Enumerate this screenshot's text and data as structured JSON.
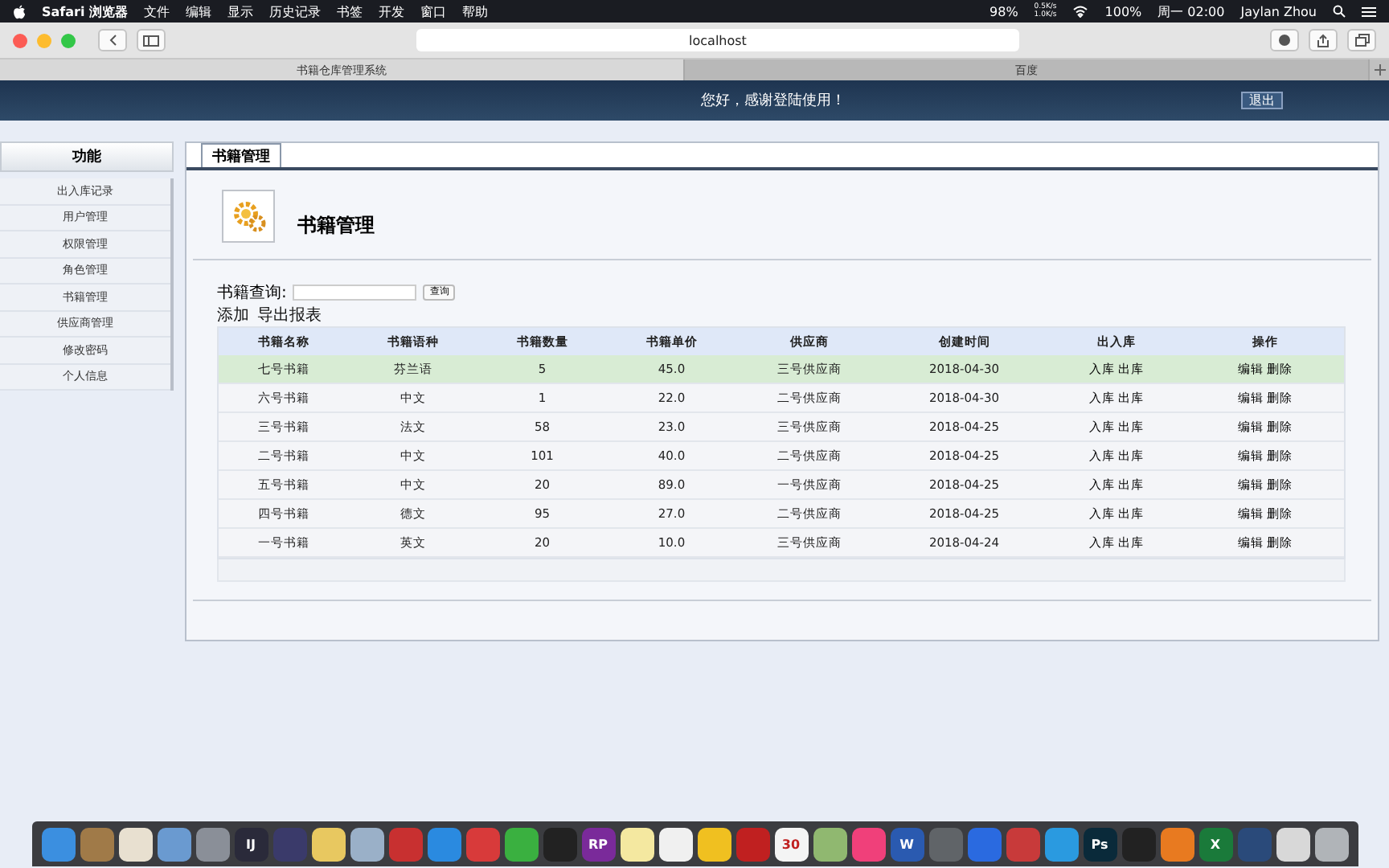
{
  "menubar": {
    "app": "Safari 浏览器",
    "menus": [
      "文件",
      "编辑",
      "显示",
      "历史记录",
      "书签",
      "开发",
      "窗口",
      "帮助"
    ],
    "status": {
      "battery_pct": "98%",
      "net_up": "0.5K/s",
      "net_down": "1.0K/s",
      "power": "100%",
      "clock": "周一 02:00",
      "user": "Jaylan Zhou"
    }
  },
  "browser": {
    "address": "localhost",
    "tabs": [
      {
        "label": "书籍仓库管理系统",
        "selected": true
      },
      {
        "label": "百度",
        "selected": false
      }
    ]
  },
  "header": {
    "greeting": "您好，感谢登陆使用！",
    "logout": "退出"
  },
  "sidebar": {
    "title": "功能",
    "items": [
      "出入库记录",
      "用户管理",
      "权限管理",
      "角色管理",
      "书籍管理",
      "供应商管理",
      "修改密码",
      "个人信息"
    ]
  },
  "panel": {
    "tab": "书籍管理",
    "title": "书籍管理",
    "search_label": "书籍查询:",
    "search_button": "查询",
    "actions": [
      "添加",
      "导出报表"
    ]
  },
  "table": {
    "columns": [
      "书籍名称",
      "书籍语种",
      "书籍数量",
      "书籍单价",
      "供应商",
      "创建时间",
      "出入库",
      "操作"
    ],
    "rows": [
      {
        "selected": true,
        "cells": [
          "七号书籍",
          "芬兰语",
          "5",
          "45.0",
          "三号供应商",
          "2018-04-30"
        ],
        "links": [
          "入库",
          "出库"
        ],
        "actions": [
          "编辑",
          "删除"
        ]
      },
      {
        "selected": false,
        "cells": [
          "六号书籍",
          "中文",
          "1",
          "22.0",
          "二号供应商",
          "2018-04-30"
        ],
        "links": [
          "入库",
          "出库"
        ],
        "actions": [
          "编辑",
          "删除"
        ]
      },
      {
        "selected": false,
        "cells": [
          "三号书籍",
          "法文",
          "58",
          "23.0",
          "三号供应商",
          "2018-04-25"
        ],
        "links": [
          "入库",
          "出库"
        ],
        "actions": [
          "编辑",
          "删除"
        ]
      },
      {
        "selected": false,
        "cells": [
          "二号书籍",
          "中文",
          "101",
          "40.0",
          "二号供应商",
          "2018-04-25"
        ],
        "links": [
          "入库",
          "出库"
        ],
        "actions": [
          "编辑",
          "删除"
        ]
      },
      {
        "selected": false,
        "cells": [
          "五号书籍",
          "中文",
          "20",
          "89.0",
          "一号供应商",
          "2018-04-25"
        ],
        "links": [
          "入库",
          "出库"
        ],
        "actions": [
          "编辑",
          "删除"
        ]
      },
      {
        "selected": false,
        "cells": [
          "四号书籍",
          "德文",
          "95",
          "27.0",
          "二号供应商",
          "2018-04-25"
        ],
        "links": [
          "入库",
          "出库"
        ],
        "actions": [
          "编辑",
          "删除"
        ]
      },
      {
        "selected": false,
        "cells": [
          "一号书籍",
          "英文",
          "20",
          "10.0",
          "三号供应商",
          "2018-04-24"
        ],
        "links": [
          "入库",
          "出库"
        ],
        "actions": [
          "编辑",
          "删除"
        ]
      }
    ]
  },
  "dock": [
    {
      "color": "#3b8fe0"
    },
    {
      "color": "#a07a48"
    },
    {
      "color": "#e8e0d0"
    },
    {
      "color": "#6a9ad0"
    },
    {
      "color": "#8a8f98"
    },
    {
      "color": "#2a2a3a",
      "label": "IJ"
    },
    {
      "color": "#3a3a6a"
    },
    {
      "color": "#e8c860"
    },
    {
      "color": "#9ab0c8"
    },
    {
      "color": "#c83030"
    },
    {
      "color": "#2a8ae0"
    },
    {
      "color": "#d83a3a"
    },
    {
      "color": "#3ab040"
    },
    {
      "color": "#222222"
    },
    {
      "color": "#7a2a9a",
      "label": "RP"
    },
    {
      "color": "#f4e8a0"
    },
    {
      "color": "#f0f0f0"
    },
    {
      "color": "#f0c020"
    },
    {
      "color": "#c02020"
    },
    {
      "color": "#f4f4f4",
      "label": "30"
    },
    {
      "color": "#90b870"
    },
    {
      "color": "#f0407a"
    },
    {
      "color": "#2a5ab0",
      "label": "W"
    },
    {
      "color": "#606468"
    },
    {
      "color": "#2a6ae0"
    },
    {
      "color": "#c83a3a"
    },
    {
      "color": "#2a9ae0"
    },
    {
      "color": "#0a2a3a",
      "label": "Ps"
    },
    {
      "color": "#222222"
    },
    {
      "color": "#e87a20"
    },
    {
      "color": "#1a7a3a",
      "label": "X"
    },
    {
      "color": "#2a4a7a"
    },
    {
      "color": "#d8d8d8"
    },
    {
      "color": "#b0b4b8"
    }
  ]
}
